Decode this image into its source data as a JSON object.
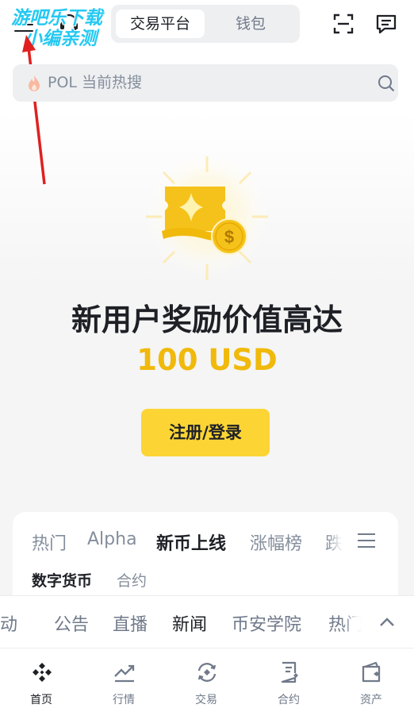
{
  "header": {
    "segments": [
      {
        "label": "交易平台",
        "active": true
      },
      {
        "label": "钱包",
        "active": false
      }
    ],
    "icons": [
      "menu-icon",
      "headset-icon",
      "scan-icon",
      "message-icon"
    ]
  },
  "watermark": {
    "line1": "游吧乐下载",
    "line2": "小编亲测"
  },
  "search": {
    "placeholder": "POL 当前热搜",
    "icons": [
      "fire-icon",
      "search-icon"
    ]
  },
  "promo": {
    "title": "新用户奖励价值高达",
    "amount": "100 USD",
    "button": "注册/登录",
    "icon": "reward-ticket-icon"
  },
  "market": {
    "tabs": [
      "热门",
      "Alpha",
      "新币上线",
      "涨幅榜",
      "跌幅榜"
    ],
    "active_tab": "新币上线",
    "subtabs": [
      "数字货币",
      "合约"
    ],
    "active_subtab": "数字货币"
  },
  "news": {
    "tabs": [
      "活动",
      "公告",
      "直播",
      "新闻",
      "币安学院",
      "热门"
    ],
    "active_tab": "新闻"
  },
  "bottom_nav": [
    {
      "label": "首页",
      "icon": "home-icon",
      "active": true
    },
    {
      "label": "行情",
      "icon": "markets-icon",
      "active": false
    },
    {
      "label": "交易",
      "icon": "trade-icon",
      "active": false
    },
    {
      "label": "合约",
      "icon": "futures-icon",
      "active": false
    },
    {
      "label": "资产",
      "icon": "wallet-icon",
      "active": false
    }
  ],
  "colors": {
    "brand_yellow": "#fcd535",
    "amount_gold": "#f0b90b",
    "text_primary": "#1e2026",
    "text_secondary": "#848e9c",
    "watermark_blue": "#25c9f2",
    "arrow_red": "#e02020"
  }
}
